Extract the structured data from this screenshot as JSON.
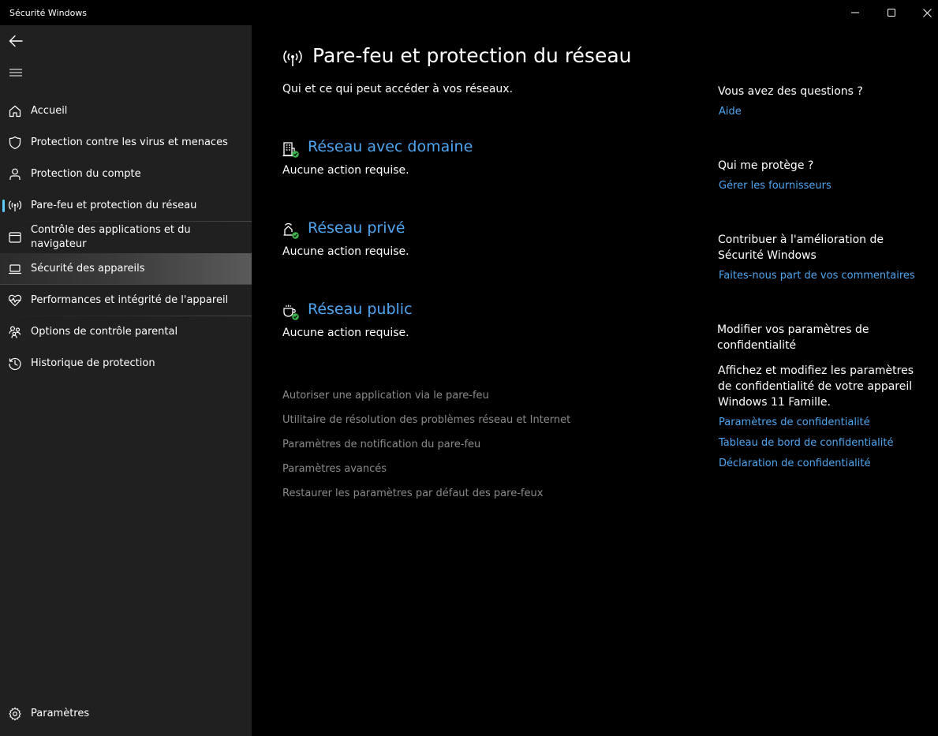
{
  "window": {
    "title": "Sécurité Windows",
    "controls": {
      "minimize_icon": "minimize-icon",
      "maximize_icon": "maximize-icon",
      "close_icon": "close-icon"
    }
  },
  "sidebar": {
    "back_icon": "back-arrow-icon",
    "menu_icon": "hamburger-menu-icon",
    "items": [
      {
        "label": "Accueil",
        "icon": "home-icon"
      },
      {
        "label": "Protection contre les virus et menaces",
        "icon": "shield-icon"
      },
      {
        "label": "Protection du compte",
        "icon": "person-icon"
      },
      {
        "label": "Pare-feu et protection du réseau",
        "icon": "antenna-icon",
        "selected": true
      },
      {
        "label": "Contrôle des applications et du navigateur",
        "icon": "app-window-icon"
      },
      {
        "label": "Sécurité des appareils",
        "icon": "laptop-icon",
        "hovered": true
      },
      {
        "label": "Performances et intégrité de l'appareil",
        "icon": "heart-pulse-icon"
      },
      {
        "label": "Options de contrôle parental",
        "icon": "family-icon"
      },
      {
        "label": "Historique de protection",
        "icon": "history-icon"
      }
    ],
    "settings": {
      "label": "Paramètres",
      "icon": "gear-icon"
    }
  },
  "main": {
    "icon": "antenna-icon",
    "title": "Pare-feu et protection du réseau",
    "subtitle": "Qui et ce qui peut accéder à vos réseaux.",
    "networks": [
      {
        "title": "Réseau avec domaine",
        "status": "Aucune action requise.",
        "icon": "domain-network-icon"
      },
      {
        "title": "Réseau privé",
        "status": "Aucune action requise.",
        "icon": "private-network-icon"
      },
      {
        "title": "Réseau public",
        "status": "Aucune action requise.",
        "icon": "public-network-icon"
      }
    ],
    "links": [
      "Autoriser une application via le pare-feu",
      "Utilitaire de résolution des problèmes réseau et Internet",
      "Paramètres de notification du pare-feu",
      "Paramètres avancés",
      "Restaurer les paramètres par défaut des pare-feux"
    ]
  },
  "aside": {
    "questions": {
      "heading": "Vous avez des questions ?",
      "link": "Aide"
    },
    "protects": {
      "heading": "Qui me protège ?",
      "link": "Gérer les fournisseurs"
    },
    "contribute": {
      "heading_line1": "Contribuer à l'amélioration de",
      "heading_line2": "Sécurité Windows",
      "link": "Faites-nous part de vos commentaires"
    },
    "privacy": {
      "heading_line1": "Modifier vos paramètres de",
      "heading_line2": "confidentialité",
      "text_line1": "Affichez et modifiez les paramètres",
      "text_line2": "de confidentialité de votre appareil",
      "text_line3": "Windows 11 Famille.",
      "links": [
        "Paramètres de confidentialité",
        "Tableau de bord de confidentialité",
        "Déclaration de confidentialité"
      ]
    }
  },
  "colors": {
    "accent": "#4ea6f0",
    "indicator": "#60cdff",
    "sidebar_bg": "#202020",
    "main_bg": "#000000",
    "muted_link": "#8a8a8a",
    "ok_green": "#3cb34a"
  }
}
